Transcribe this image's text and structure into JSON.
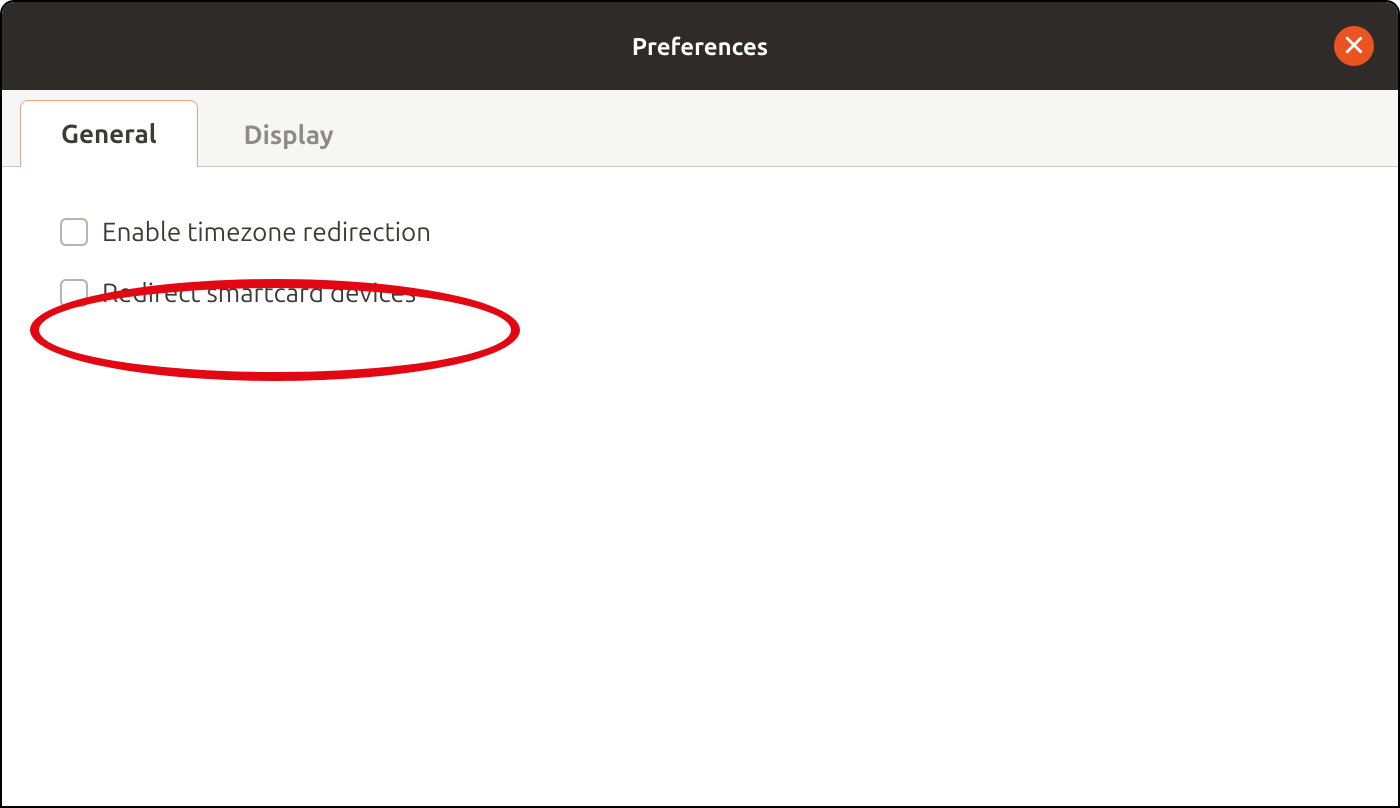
{
  "window": {
    "title": "Preferences"
  },
  "tabs": [
    {
      "label": "General",
      "active": true
    },
    {
      "label": "Display",
      "active": false
    }
  ],
  "options": [
    {
      "label": "Enable timezone redirection",
      "checked": false
    },
    {
      "label": "Redirect smartcard devices",
      "checked": false
    }
  ],
  "annotation": {
    "highlight_option_index": 1
  }
}
